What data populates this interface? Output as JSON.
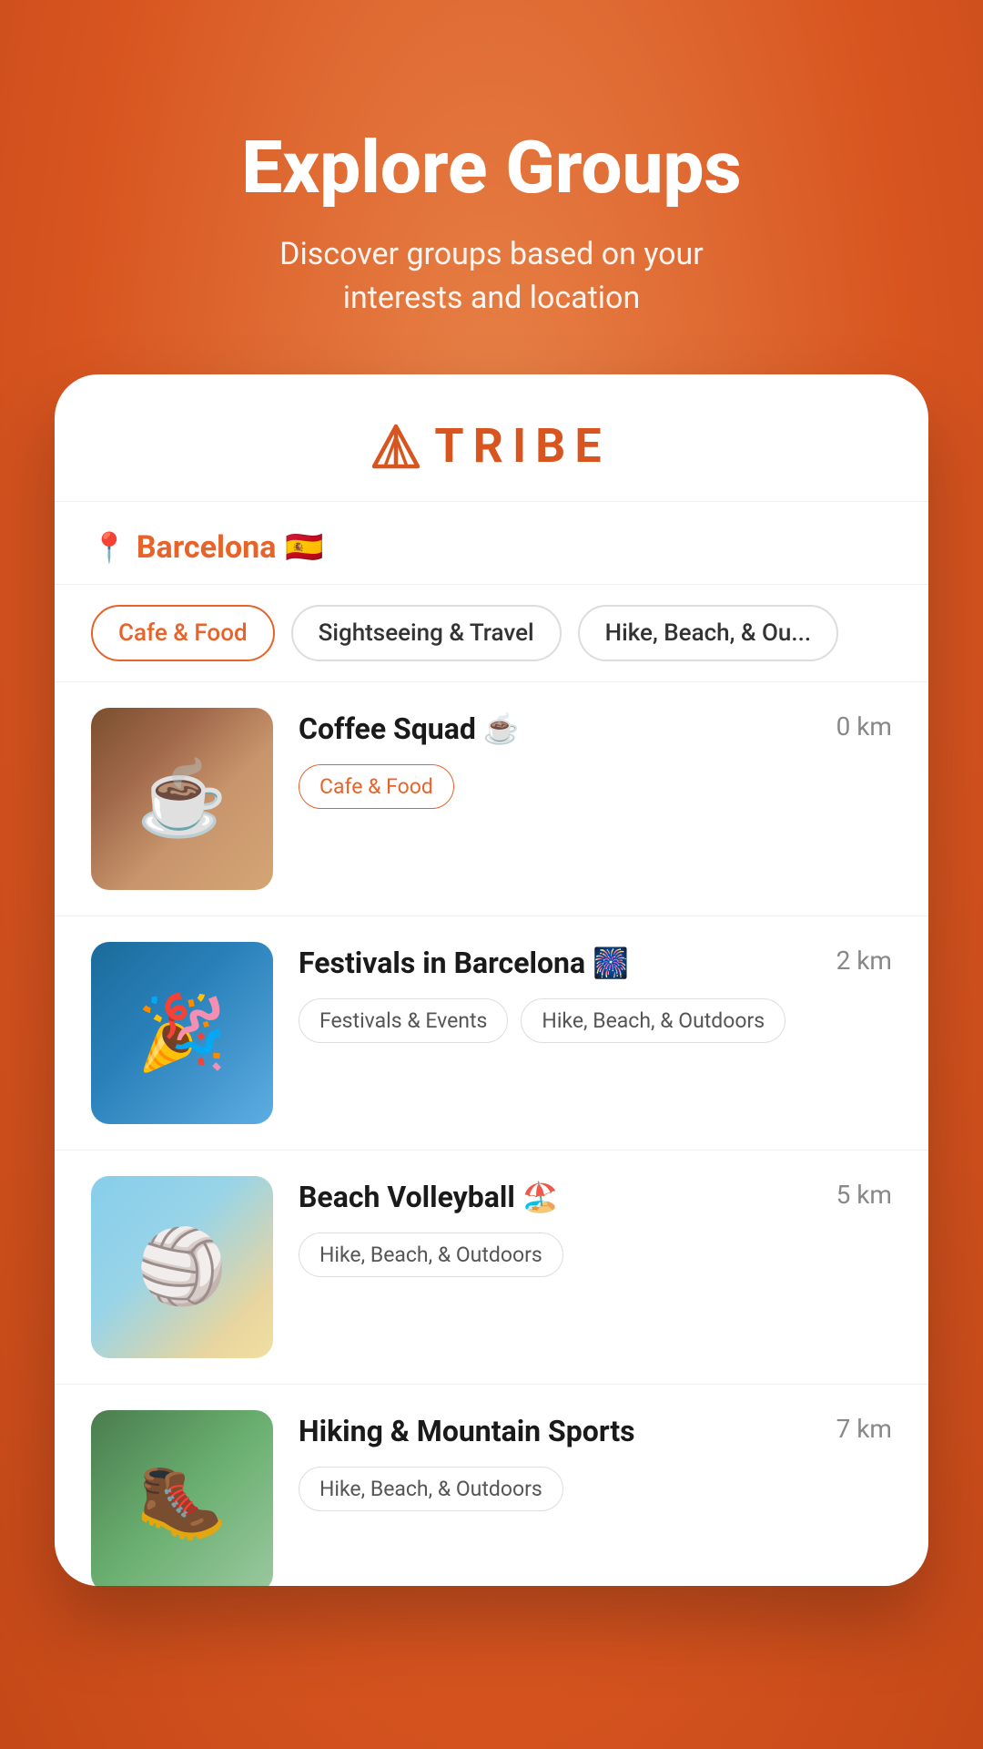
{
  "background": {
    "color": "#E8632A"
  },
  "hero": {
    "title": "Explore Groups",
    "subtitle": "Discover groups based on your interests and location"
  },
  "app": {
    "logo_text": "TRIBE",
    "logo_icon": "tent"
  },
  "location": {
    "city": "Barcelona",
    "flag": "🇪🇸"
  },
  "filter_tabs": [
    {
      "label": "Cafe & Food",
      "active": true
    },
    {
      "label": "Sightseeing & Travel",
      "active": false
    },
    {
      "label": "Hike, Beach, & Ou...",
      "active": false
    }
  ],
  "groups": [
    {
      "id": "coffee-squad",
      "name": "Coffee Squad ☕",
      "distance": "0 km",
      "image_type": "coffee",
      "tags": [
        {
          "label": "Cafe & Food",
          "style": "orange"
        }
      ]
    },
    {
      "id": "festivals-barcelona",
      "name": "Festivals in Barcelona 🎆",
      "distance": "2 km",
      "image_type": "festival",
      "tags": [
        {
          "label": "Festivals & Events",
          "style": "normal"
        },
        {
          "label": "Hike, Beach, & Outdoors",
          "style": "normal"
        }
      ]
    },
    {
      "id": "beach-volleyball",
      "name": "Beach Volleyball 🏖️",
      "distance": "5 km",
      "image_type": "volleyball",
      "tags": [
        {
          "label": "Hike, Beach, & Outdoors",
          "style": "normal"
        }
      ]
    },
    {
      "id": "hiking-mountain",
      "name": "Hiking & Mountain Sports",
      "distance": "7 km",
      "image_type": "hiking",
      "tags": [
        {
          "label": "Hike, Beach, & Outdoors",
          "style": "normal"
        }
      ]
    }
  ]
}
